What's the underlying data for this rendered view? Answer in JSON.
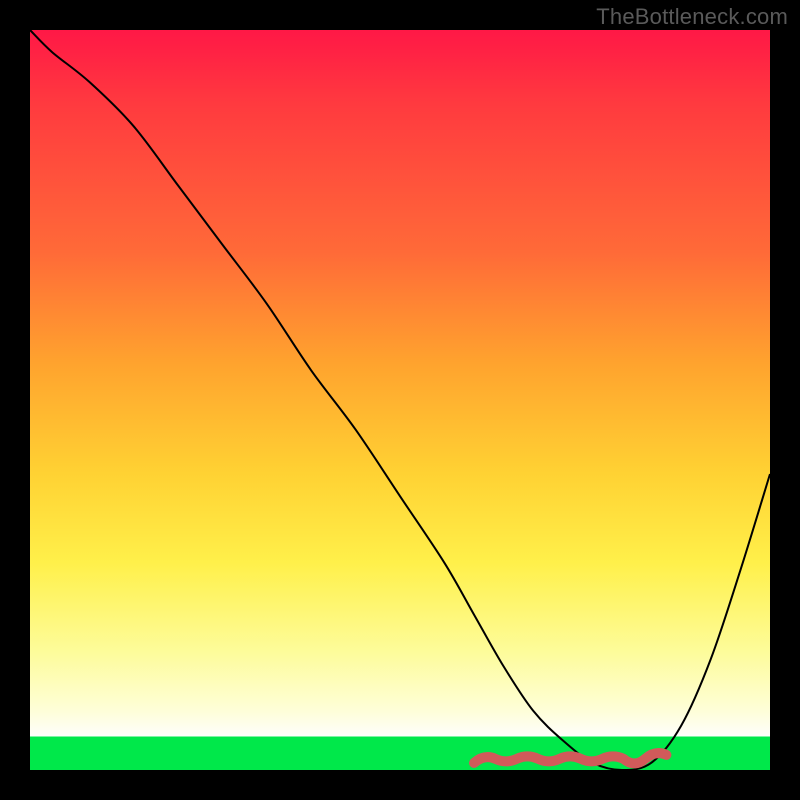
{
  "watermark": "TheBottleneck.com",
  "chart_data": {
    "type": "line",
    "title": "",
    "xlabel": "",
    "ylabel": "",
    "xlim": [
      0,
      100
    ],
    "ylim": [
      0,
      100
    ],
    "series": [
      {
        "name": "bottleneck-curve",
        "x": [
          0,
          3,
          8,
          14,
          20,
          26,
          32,
          38,
          44,
          50,
          56,
          60,
          64,
          68,
          72,
          76,
          80,
          84,
          88,
          92,
          96,
          100
        ],
        "y": [
          100,
          97,
          93,
          87,
          79,
          71,
          63,
          54,
          46,
          37,
          28,
          21,
          14,
          8,
          4,
          1,
          0,
          1,
          6,
          15,
          27,
          40
        ]
      }
    ],
    "annotations": [
      {
        "name": "optimal-range-squiggle",
        "x_start": 60,
        "x_end": 86,
        "y": 1.5
      }
    ],
    "background_gradient": {
      "stops": [
        {
          "pos": 0.0,
          "color": "#ff1846"
        },
        {
          "pos": 0.3,
          "color": "#ff6a38"
        },
        {
          "pos": 0.6,
          "color": "#ffd233"
        },
        {
          "pos": 0.84,
          "color": "#fdfc9a"
        },
        {
          "pos": 0.955,
          "color": "#fefefc"
        },
        {
          "pos": 0.956,
          "color": "#00e84a"
        },
        {
          "pos": 1.0,
          "color": "#00e84a"
        }
      ]
    }
  }
}
